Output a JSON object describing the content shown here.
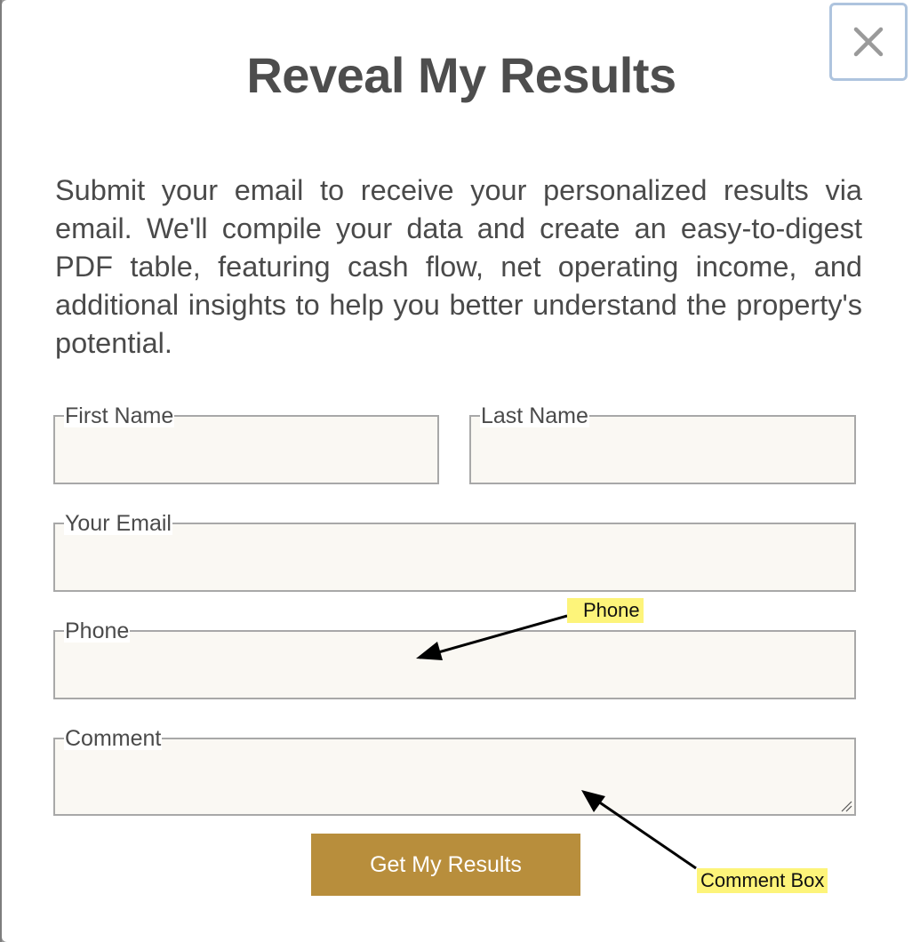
{
  "modal": {
    "title": "Reveal My Results",
    "intro": "Submit your email to receive your personalized results via email. We'll compile your data and create an easy-to-digest PDF table, featuring cash flow, net operating income, and additional insights to help you better understand the property's potential.",
    "close_icon": "close-icon"
  },
  "form": {
    "first_name": {
      "label": "First Name",
      "value": ""
    },
    "last_name": {
      "label": "Last Name",
      "value": ""
    },
    "email": {
      "label": "Your Email",
      "value": ""
    },
    "phone": {
      "label": "Phone",
      "value": ""
    },
    "comment": {
      "label": "Comment",
      "value": ""
    },
    "submit_label": "Get My Results"
  },
  "annotations": {
    "phone": "Phone",
    "comment": "Comment Box",
    "highlight_color": "#fdf47a"
  },
  "colors": {
    "accent": "#b88e3c",
    "field_bg": "#faf8f3",
    "close_border": "#aec4de",
    "text": "#4a4a4a"
  }
}
